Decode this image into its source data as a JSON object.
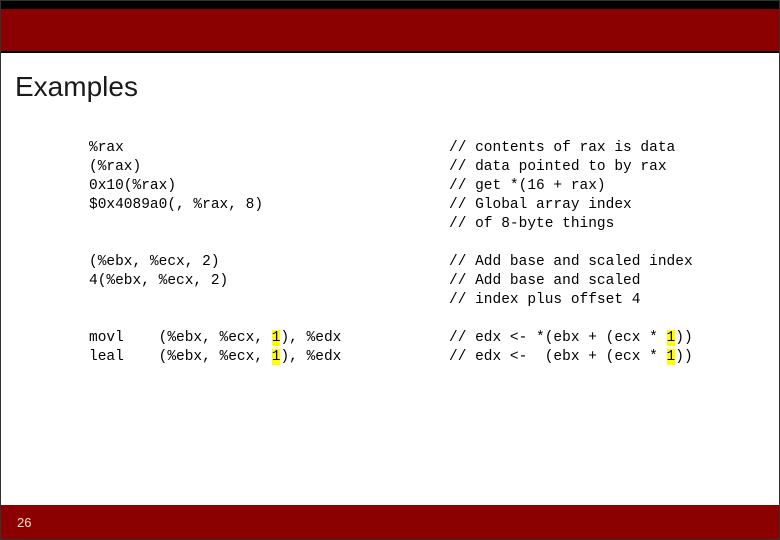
{
  "title": "Examples",
  "page_number": "26",
  "code": {
    "block1_left": [
      "%rax",
      "(%rax)",
      "0x10(%rax)",
      "$0x4089a0(, %rax, 8)",
      ""
    ],
    "block1_right": [
      "// contents of rax is data",
      "// data pointed to by rax",
      "// get *(16 + rax)",
      "// Global array index",
      "// of 8-byte things"
    ],
    "block2_left": [
      "(%ebx, %ecx, 2)",
      "4(%ebx, %ecx, 2)",
      ""
    ],
    "block2_right": [
      "// Add base and scaled index",
      "// Add base and scaled",
      "// index plus offset 4"
    ],
    "b3r1_l1": "movl    (%ebx, %ecx, ",
    "b3r1_hl": "1",
    "b3r1_l2": "), %edx",
    "b3r1_r1": "// edx <- *(ebx + (ecx * ",
    "b3r1_rhl": "1",
    "b3r1_r2": "))",
    "b3r2_l1": "leal    (%ebx, %ecx, ",
    "b3r2_hl": "1",
    "b3r2_l2": "), %edx",
    "b3r2_r1": "// edx <-  (ebx + (ecx * ",
    "b3r2_rhl": "1",
    "b3r2_r2": "))"
  }
}
